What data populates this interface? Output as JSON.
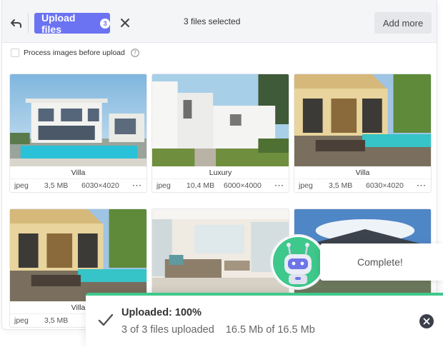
{
  "topbar": {
    "upload_label": "Upload files",
    "upload_badge": "3",
    "selected_text": "3 files selected",
    "add_more_label": "Add more"
  },
  "options": {
    "process_label": "Process images before upload"
  },
  "cards": [
    {
      "title": "Villa",
      "ext": "jpeg",
      "size": "3,5 MB",
      "dims": "6030×4020",
      "more": "···"
    },
    {
      "title": "Luxury",
      "ext": "jpeg",
      "size": "10,4 MB",
      "dims": "6000×4000",
      "more": "···"
    },
    {
      "title": "Villa",
      "ext": "jpeg",
      "size": "3,5 MB",
      "dims": "6030×4020",
      "more": "···"
    },
    {
      "title": "Villa",
      "ext": "jpeg",
      "size": "3,5 MB"
    }
  ],
  "toast": {
    "complete_text": "Complete!"
  },
  "status": {
    "title": "Uploaded: 100%",
    "files_text": "3 of 3 files uploaded",
    "bytes_text": "16.5 Mb of 16.5 Mb",
    "progress_percent": 100
  },
  "colors": {
    "accent": "#6b73f2",
    "success": "#3ec88b",
    "mascot": "#3ec88b"
  }
}
